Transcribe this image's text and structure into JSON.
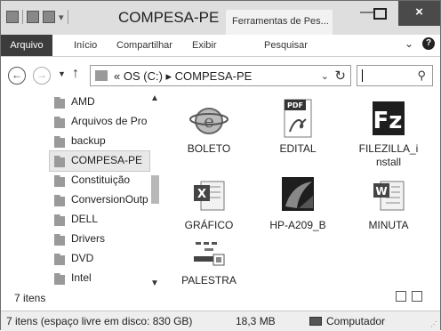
{
  "window": {
    "title": "COMPESA-PE",
    "context_tab": "Ferramentas de Pes...",
    "close_glyph": "×",
    "min_glyph": "—"
  },
  "ribbon": {
    "tabs": [
      "Arquivo",
      "Início",
      "Compartilhar",
      "Exibir",
      "Pesquisar"
    ]
  },
  "address": {
    "path": "« OS (C:) ▸ COMPESA-PE",
    "search_placeholder": ""
  },
  "nav": {
    "items": [
      {
        "label": "AMD"
      },
      {
        "label": "Arquivos de Pro"
      },
      {
        "label": "backup"
      },
      {
        "label": "COMPESA-PE",
        "selected": true
      },
      {
        "label": "Constituição"
      },
      {
        "label": "ConversionOutp"
      },
      {
        "label": "DELL"
      },
      {
        "label": "Drivers"
      },
      {
        "label": "DVD"
      },
      {
        "label": "Intel"
      }
    ]
  },
  "files": [
    {
      "name": "BOLETO",
      "icon": "html-document-icon"
    },
    {
      "name": "EDITAL",
      "icon": "pdf-icon",
      "badge": "PDF"
    },
    {
      "name": "FILEZILLA_installer",
      "display": [
        "FILEZILLA_i",
        "nstall"
      ],
      "icon": "filezilla-icon"
    },
    {
      "name": "GRÁFICO",
      "icon": "excel-icon"
    },
    {
      "name": "HP-A209_B",
      "icon": "hp-app-icon"
    },
    {
      "name": "MINUTA",
      "icon": "word-icon"
    },
    {
      "name": "PALESTRA",
      "icon": "presentation-icon"
    }
  ],
  "item_count": "7 itens",
  "status": {
    "free_space": "7 itens (espaço livre em disco: 830 GB)",
    "size": "18,3 MB",
    "location": "Computador"
  }
}
